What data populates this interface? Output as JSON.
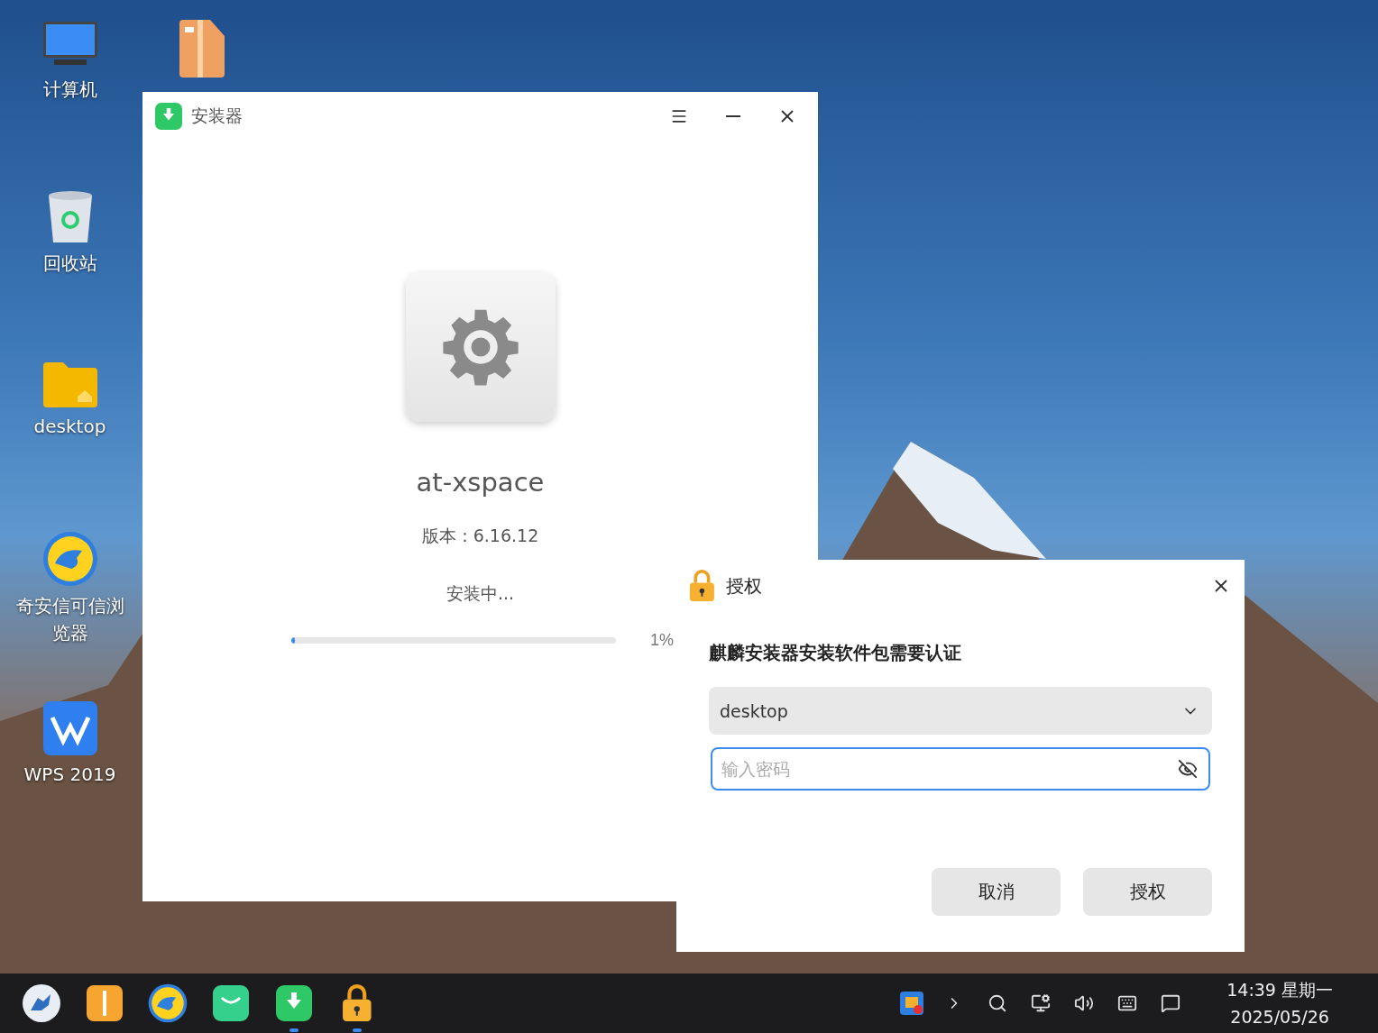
{
  "desktop_icons": [
    {
      "kind": "computer",
      "label": "计算机"
    },
    {
      "kind": "trash",
      "label": "回收站"
    },
    {
      "kind": "folder",
      "label": "desktop"
    },
    {
      "kind": "browser",
      "label": "奇安信可信浏览器"
    },
    {
      "kind": "wps",
      "label": "WPS 2019"
    },
    {
      "kind": "package"
    }
  ],
  "installer": {
    "title": "安装器",
    "app_name": "at-xspace",
    "version": "版本：6.16.12",
    "status": "安装中...",
    "progress": {
      "level": 0.01,
      "reading": "1%"
    }
  },
  "auth_dialog": {
    "title": "授权",
    "message": "麒麟安装器安装软件包需要认证",
    "user": "desktop",
    "password": {
      "placeholder": "输入密码"
    },
    "buttons": [
      "取消",
      "授权"
    ]
  },
  "taskbar": {
    "apps": [
      {
        "kind": "start",
        "running": false
      },
      {
        "kind": "files",
        "running": false
      },
      {
        "kind": "browser",
        "running": false
      },
      {
        "kind": "mail",
        "running": false
      },
      {
        "kind": "installer",
        "running": true
      },
      {
        "kind": "lock",
        "running": true
      }
    ],
    "clock": {
      "time": "14:39 星期一",
      "date": "2025/05/26"
    }
  }
}
